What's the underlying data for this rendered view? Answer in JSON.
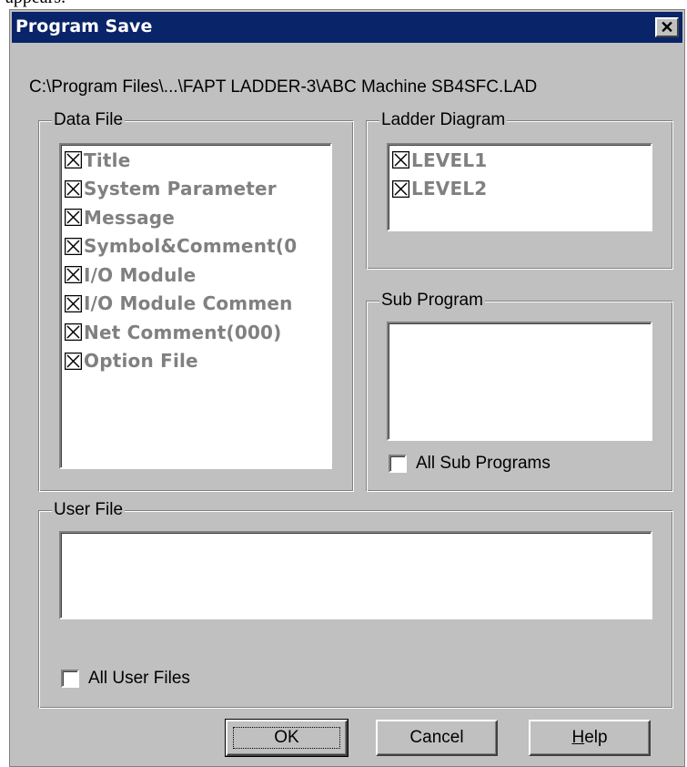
{
  "top_fragment": "appears.",
  "window": {
    "title": "Program Save",
    "close_glyph": "✕"
  },
  "path": "C:\\Program Files\\...\\FAPT LADDER-3\\ABC Machine SB4SFC.LAD",
  "data_file": {
    "label": "Data File",
    "items": [
      {
        "label": "Title",
        "checked": true
      },
      {
        "label": "System Parameter",
        "checked": true
      },
      {
        "label": "Message",
        "checked": true
      },
      {
        "label": "Symbol&Comment(0",
        "checked": true
      },
      {
        "label": "I/O Module",
        "checked": true
      },
      {
        "label": "I/O Module Commen",
        "checked": true
      },
      {
        "label": "Net Comment(000)",
        "checked": true
      },
      {
        "label": "Option File",
        "checked": true
      }
    ]
  },
  "ladder_diagram": {
    "label": "Ladder Diagram",
    "items": [
      {
        "label": "LEVEL1",
        "checked": true
      },
      {
        "label": "LEVEL2",
        "checked": true
      }
    ]
  },
  "sub_program": {
    "label": "Sub Program",
    "all_label": "All Sub Programs",
    "all_checked": false
  },
  "user_file": {
    "label": "User File",
    "all_label": "All User Files",
    "all_checked": false
  },
  "buttons": {
    "ok": "OK",
    "cancel": "Cancel",
    "help_mnemonic": "H",
    "help_rest": "elp"
  },
  "colors": {
    "titlebar": "#0a246a",
    "dialog_face": "#c0c0c0",
    "disabled_text": "#808080"
  }
}
